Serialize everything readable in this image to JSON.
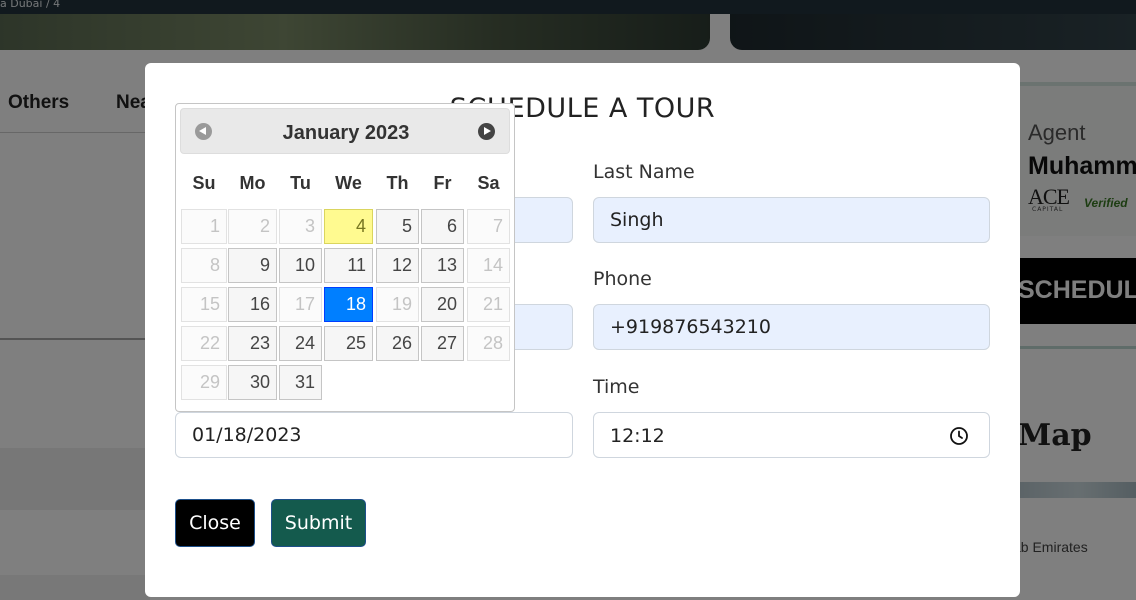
{
  "background": {
    "topbar_text": "a Dubai / 4",
    "nav_items": [
      "Others",
      "Nea"
    ],
    "agent": {
      "label": "Agent",
      "name": "Muhamm",
      "company_logo_text": "ACE",
      "company_logo_sub": "CAPITAL",
      "verified_text": "Verified"
    },
    "schedule_button_label": "SCHEDUL",
    "map_title": "Map",
    "map_location": "ab Emirates"
  },
  "modal": {
    "title": "SCHEDULE A TOUR",
    "last_name": {
      "label": "Last Name",
      "value": "Singh"
    },
    "phone": {
      "label": "Phone",
      "value": "+919876543210"
    },
    "date": {
      "value": "01/18/2023"
    },
    "time": {
      "label": "Time",
      "value": "12:12"
    },
    "close_label": "Close",
    "submit_label": "Submit"
  },
  "datepicker": {
    "month_title": "January 2023",
    "weekdays": [
      "Su",
      "Mo",
      "Tu",
      "We",
      "Th",
      "Fr",
      "Sa"
    ],
    "weeks": [
      [
        {
          "d": "1",
          "s": "muted"
        },
        {
          "d": "2",
          "s": "muted"
        },
        {
          "d": "3",
          "s": "muted"
        },
        {
          "d": "4",
          "s": "today"
        },
        {
          "d": "5",
          "s": "normal"
        },
        {
          "d": "6",
          "s": "normal"
        },
        {
          "d": "7",
          "s": "muted"
        }
      ],
      [
        {
          "d": "8",
          "s": "muted"
        },
        {
          "d": "9",
          "s": "normal"
        },
        {
          "d": "10",
          "s": "normal"
        },
        {
          "d": "11",
          "s": "normal"
        },
        {
          "d": "12",
          "s": "normal"
        },
        {
          "d": "13",
          "s": "normal"
        },
        {
          "d": "14",
          "s": "muted"
        }
      ],
      [
        {
          "d": "15",
          "s": "muted"
        },
        {
          "d": "16",
          "s": "normal"
        },
        {
          "d": "17",
          "s": "muted"
        },
        {
          "d": "18",
          "s": "selected"
        },
        {
          "d": "19",
          "s": "muted"
        },
        {
          "d": "20",
          "s": "normal"
        },
        {
          "d": "21",
          "s": "muted"
        }
      ],
      [
        {
          "d": "22",
          "s": "muted"
        },
        {
          "d": "23",
          "s": "normal"
        },
        {
          "d": "24",
          "s": "normal"
        },
        {
          "d": "25",
          "s": "normal"
        },
        {
          "d": "26",
          "s": "normal"
        },
        {
          "d": "27",
          "s": "normal"
        },
        {
          "d": "28",
          "s": "muted"
        }
      ],
      [
        {
          "d": "29",
          "s": "muted"
        },
        {
          "d": "30",
          "s": "normal"
        },
        {
          "d": "31",
          "s": "normal"
        }
      ]
    ]
  }
}
